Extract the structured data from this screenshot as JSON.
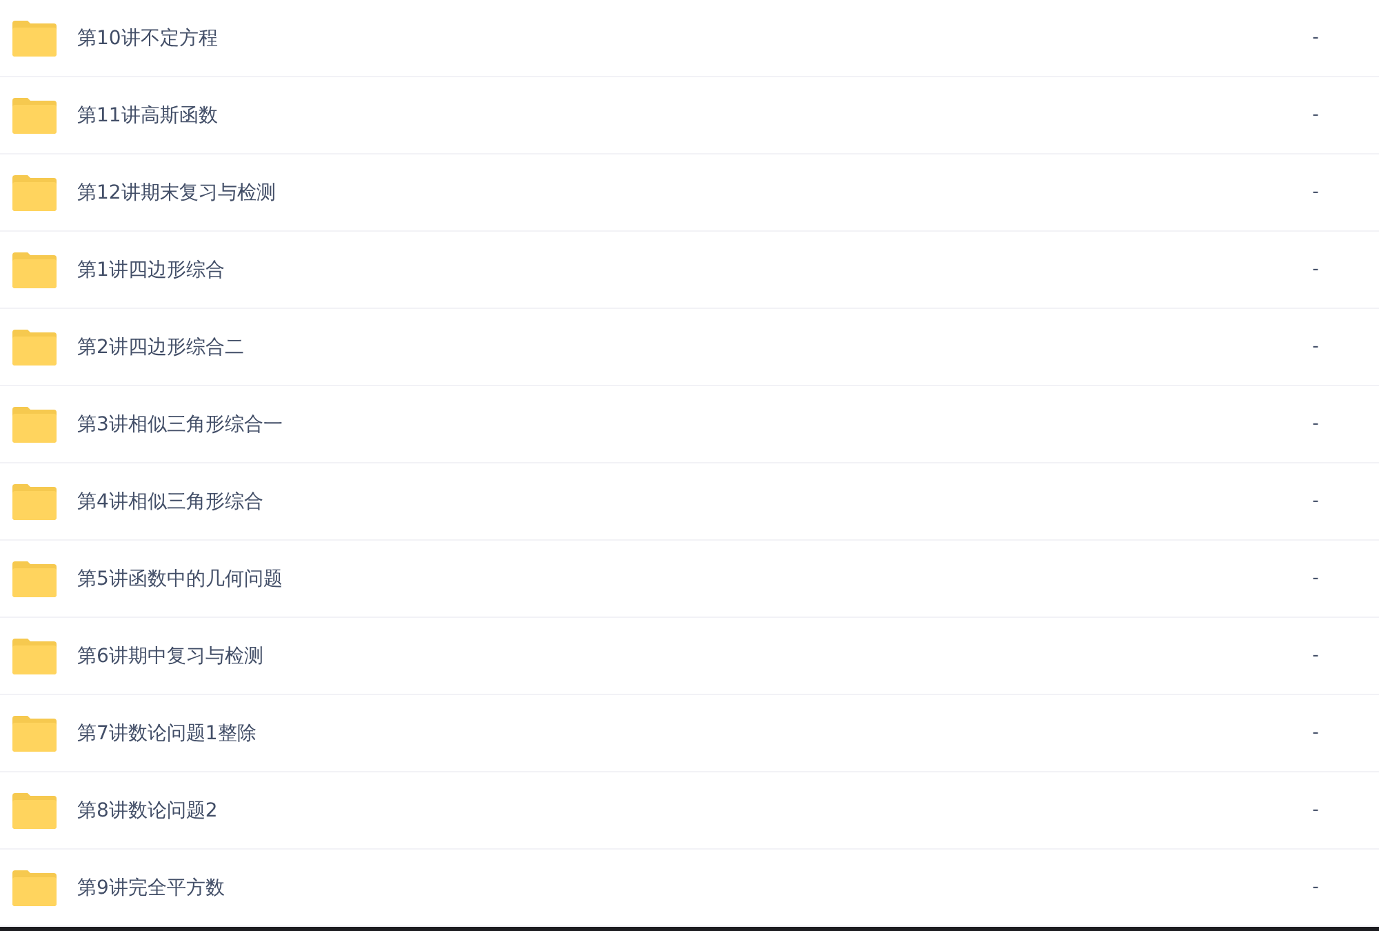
{
  "files": [
    {
      "name": "第10讲不定方程",
      "size": "-"
    },
    {
      "name": "第11讲高斯函数",
      "size": "-"
    },
    {
      "name": "第12讲期末复习与检测",
      "size": "-"
    },
    {
      "name": "第1讲四边形综合",
      "size": "-"
    },
    {
      "name": "第2讲四边形综合二",
      "size": "-"
    },
    {
      "name": "第3讲相似三角形综合一",
      "size": "-"
    },
    {
      "name": "第4讲相似三角形综合",
      "size": "-"
    },
    {
      "name": "第5讲函数中的几何问题",
      "size": "-"
    },
    {
      "name": "第6讲期中复习与检测",
      "size": "-"
    },
    {
      "name": "第7讲数论问题1整除",
      "size": "-"
    },
    {
      "name": "第8讲数论问题2",
      "size": "-"
    },
    {
      "name": "第9讲完全平方数",
      "size": "-"
    }
  ]
}
